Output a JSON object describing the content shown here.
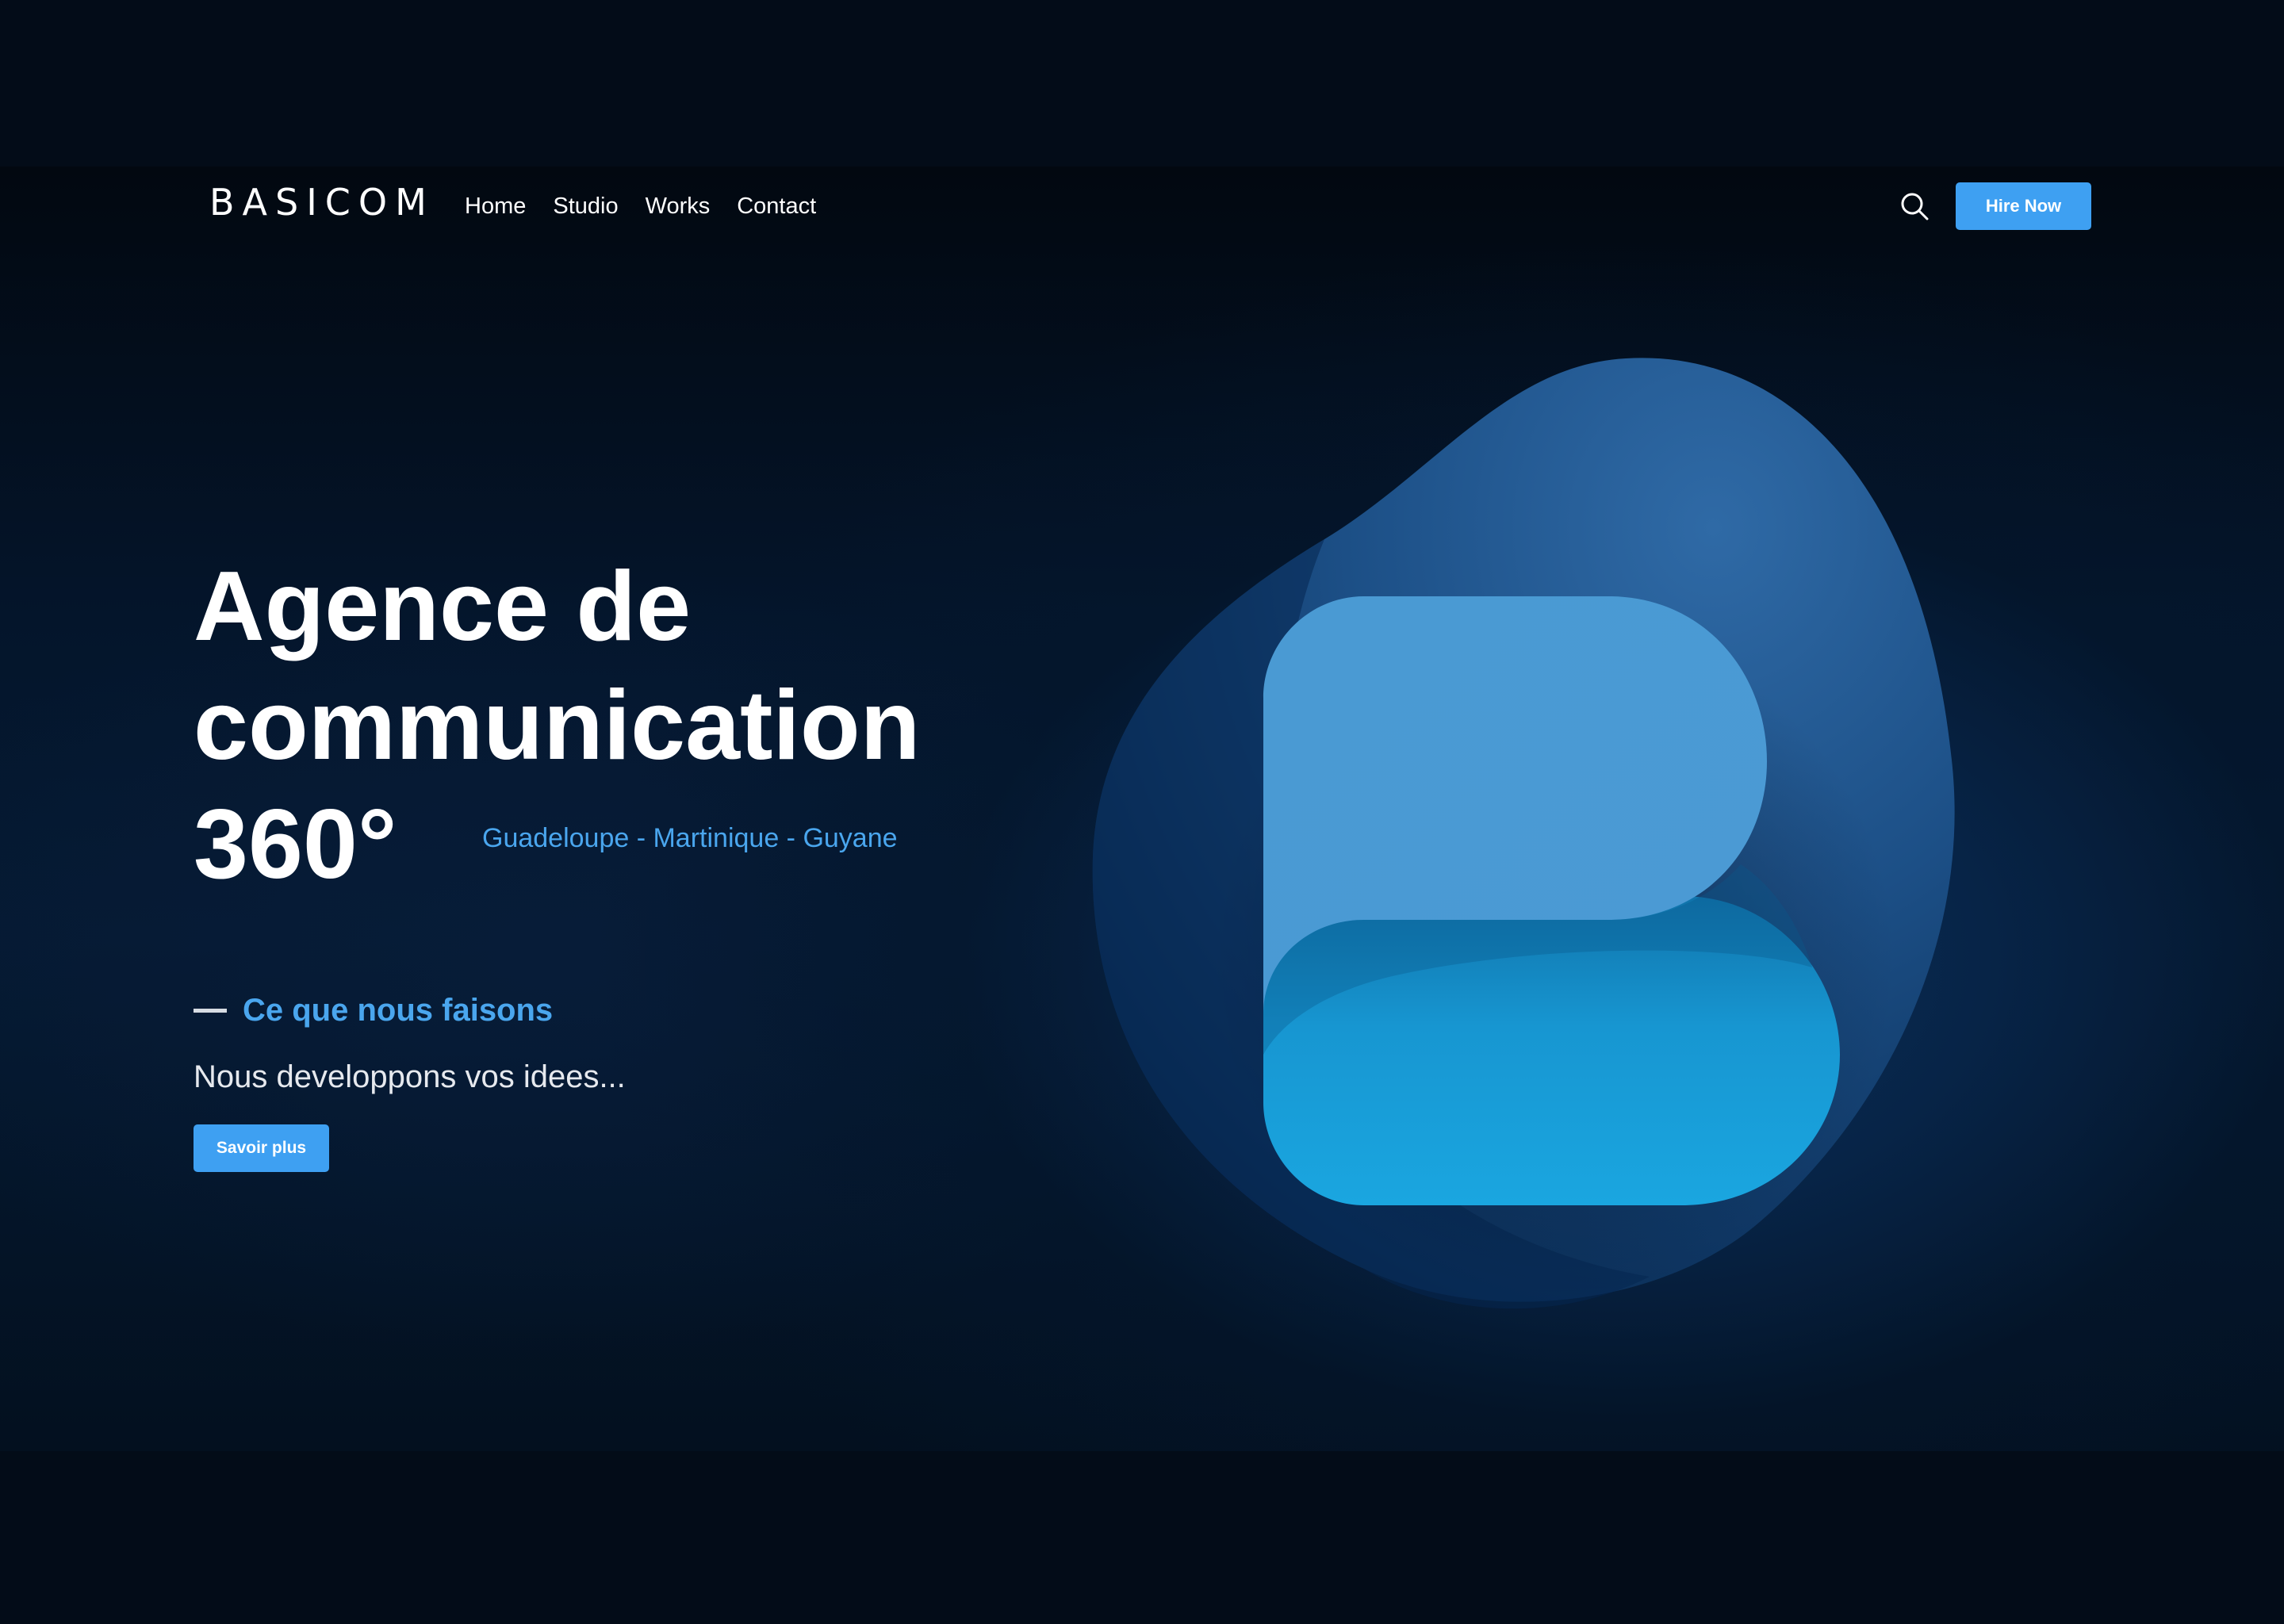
{
  "header": {
    "brand": "BASICOM",
    "nav": [
      "Home",
      "Studio",
      "Works",
      "Contact"
    ],
    "search_icon": "search-icon",
    "cta_label": "Hire Now"
  },
  "hero": {
    "headline": [
      "Agence de",
      "communication",
      "360°"
    ],
    "regions": "Guadeloupe - Martinique - Guyane",
    "section_label": "Ce que nous faisons",
    "tagline": "Nous developpons vos idees...",
    "cta_label": "Savoir plus",
    "illustration": "basicom-b-logo"
  },
  "colors": {
    "accent": "#3ea0f2",
    "accent_text": "#4aa6ee",
    "background": "#030c18"
  }
}
